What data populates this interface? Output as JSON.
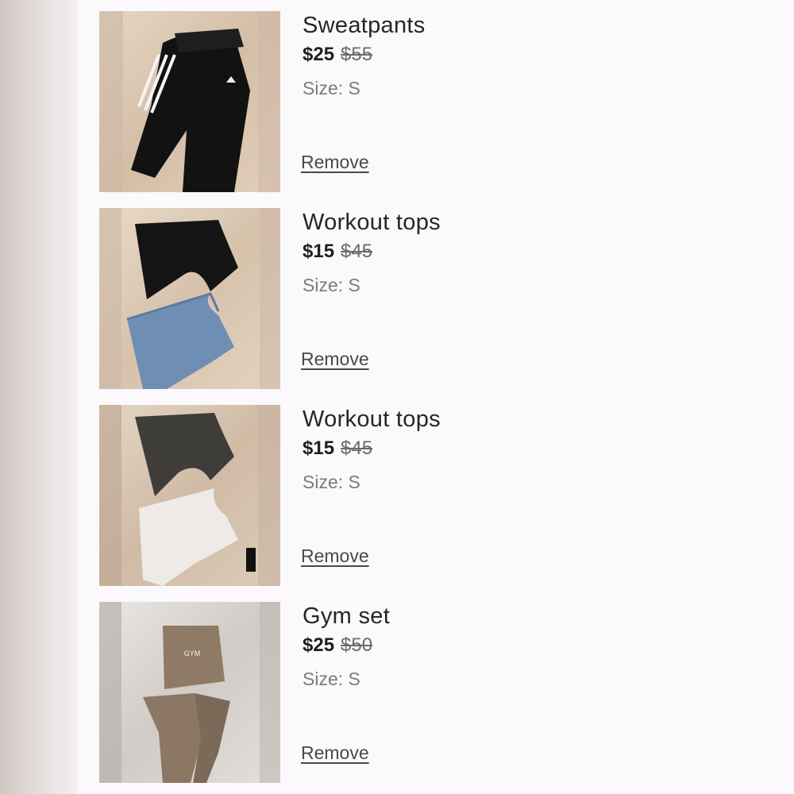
{
  "cart": {
    "items": [
      {
        "title": "Sweatpants",
        "price": "$25",
        "original_price": "$55",
        "size": "Size: S",
        "remove_label": "Remove",
        "image": "black-striped-sweatpants-photo"
      },
      {
        "title": "Workout tops",
        "price": "$15",
        "original_price": "$45",
        "size": "Size: S",
        "remove_label": "Remove",
        "image": "black-and-blue-crop-tops-photo"
      },
      {
        "title": "Workout tops",
        "price": "$15",
        "original_price": "$45",
        "size": "Size: S",
        "remove_label": "Remove",
        "image": "grey-and-white-crop-tops-photo"
      },
      {
        "title": "Gym set",
        "price": "$25",
        "original_price": "$50",
        "size": "Size: S",
        "remove_label": "Remove",
        "image": "brown-gym-set-photo",
        "image_print": "GYM"
      }
    ]
  },
  "colors": {
    "background": "#fbf9fb",
    "text": "#262626",
    "muted": "#7c7c7c"
  }
}
